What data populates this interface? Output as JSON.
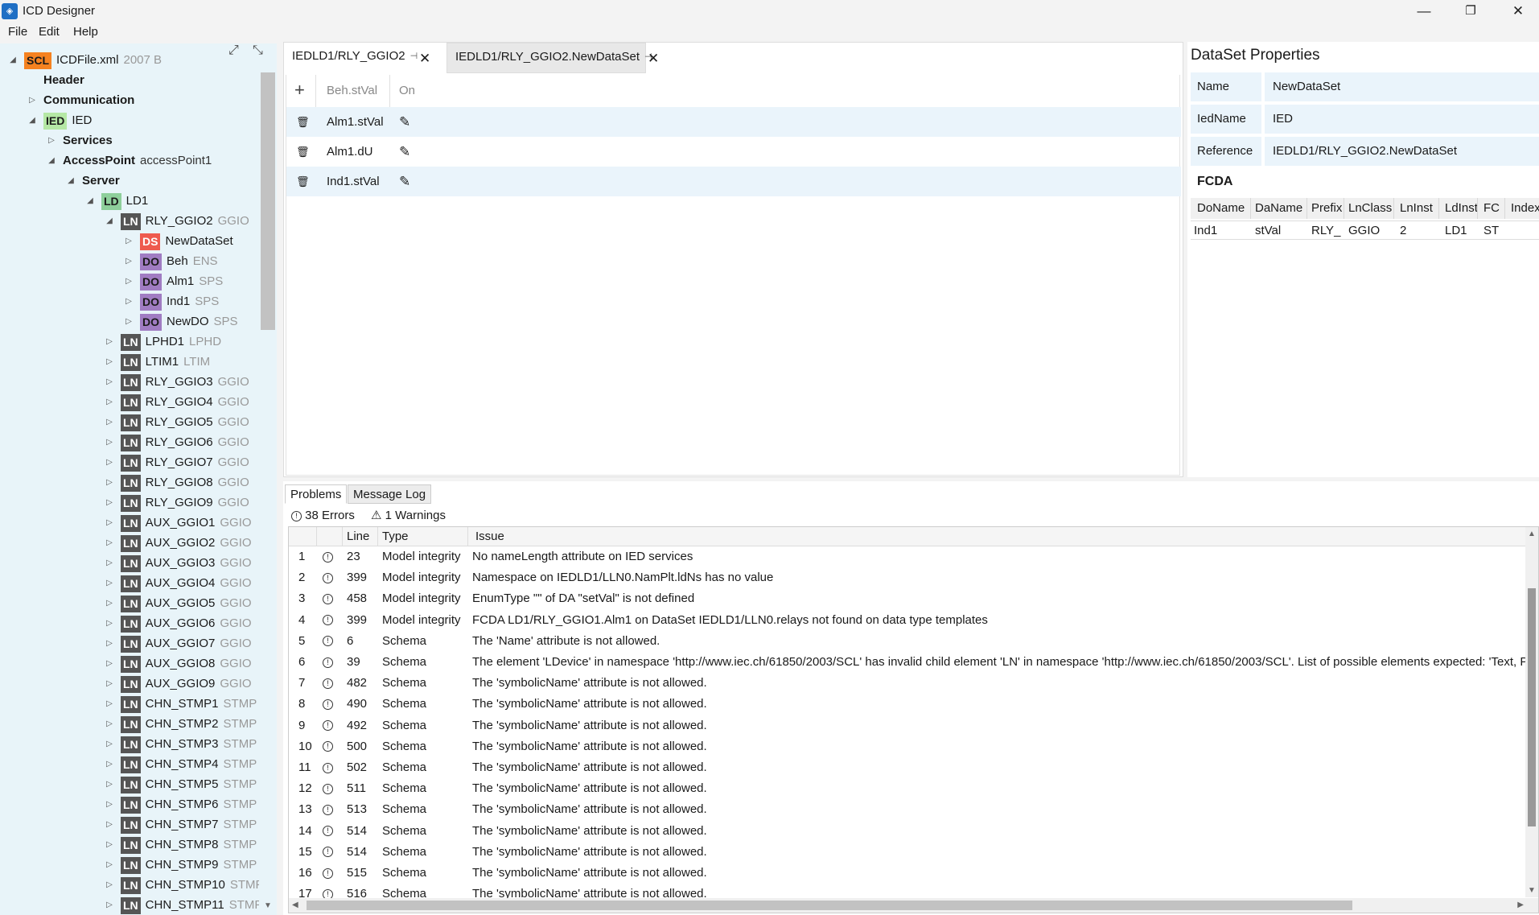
{
  "window": {
    "title": "ICD Designer",
    "controls": {
      "minimize": "—",
      "maximize": "❐",
      "close": "✕"
    }
  },
  "menu": [
    "File",
    "Edit",
    "Help"
  ],
  "tree": {
    "root": {
      "badge": "SCL",
      "name": "ICDFile.xml",
      "sub": "2007 B"
    },
    "header": "Header",
    "communication": "Communication",
    "ied": {
      "badge": "IED",
      "name": "IED"
    },
    "services": "Services",
    "accesspoint": {
      "name": "AccessPoint",
      "sub": "accessPoint1"
    },
    "server": "Server",
    "ld": {
      "badge": "LD",
      "name": "LD1"
    },
    "ln_open": {
      "badge": "LN",
      "name": "RLY_GGIO2",
      "sub": "GGIO"
    },
    "children": [
      {
        "badge": "DS",
        "name": "NewDataSet",
        "sub": ""
      },
      {
        "badge": "DO",
        "name": "Beh",
        "sub": "ENS"
      },
      {
        "badge": "DO",
        "name": "Alm1",
        "sub": "SPS"
      },
      {
        "badge": "DO",
        "name": "Ind1",
        "sub": "SPS"
      },
      {
        "badge": "DO",
        "name": "NewDO",
        "sub": "SPS"
      }
    ],
    "lns": [
      {
        "badge": "LN",
        "name": "LPHD1",
        "sub": "LPHD"
      },
      {
        "badge": "LN",
        "name": "LTIM1",
        "sub": "LTIM"
      },
      {
        "badge": "LN",
        "name": "RLY_GGIO3",
        "sub": "GGIO"
      },
      {
        "badge": "LN",
        "name": "RLY_GGIO4",
        "sub": "GGIO"
      },
      {
        "badge": "LN",
        "name": "RLY_GGIO5",
        "sub": "GGIO"
      },
      {
        "badge": "LN",
        "name": "RLY_GGIO6",
        "sub": "GGIO"
      },
      {
        "badge": "LN",
        "name": "RLY_GGIO7",
        "sub": "GGIO"
      },
      {
        "badge": "LN",
        "name": "RLY_GGIO8",
        "sub": "GGIO"
      },
      {
        "badge": "LN",
        "name": "RLY_GGIO9",
        "sub": "GGIO"
      },
      {
        "badge": "LN",
        "name": "AUX_GGIO1",
        "sub": "GGIO"
      },
      {
        "badge": "LN",
        "name": "AUX_GGIO2",
        "sub": "GGIO"
      },
      {
        "badge": "LN",
        "name": "AUX_GGIO3",
        "sub": "GGIO"
      },
      {
        "badge": "LN",
        "name": "AUX_GGIO4",
        "sub": "GGIO"
      },
      {
        "badge": "LN",
        "name": "AUX_GGIO5",
        "sub": "GGIO"
      },
      {
        "badge": "LN",
        "name": "AUX_GGIO6",
        "sub": "GGIO"
      },
      {
        "badge": "LN",
        "name": "AUX_GGIO7",
        "sub": "GGIO"
      },
      {
        "badge": "LN",
        "name": "AUX_GGIO8",
        "sub": "GGIO"
      },
      {
        "badge": "LN",
        "name": "AUX_GGIO9",
        "sub": "GGIO"
      },
      {
        "badge": "LN",
        "name": "CHN_STMP1",
        "sub": "STMP"
      },
      {
        "badge": "LN",
        "name": "CHN_STMP2",
        "sub": "STMP"
      },
      {
        "badge": "LN",
        "name": "CHN_STMP3",
        "sub": "STMP"
      },
      {
        "badge": "LN",
        "name": "CHN_STMP4",
        "sub": "STMP"
      },
      {
        "badge": "LN",
        "name": "CHN_STMP5",
        "sub": "STMP"
      },
      {
        "badge": "LN",
        "name": "CHN_STMP6",
        "sub": "STMP"
      },
      {
        "badge": "LN",
        "name": "CHN_STMP7",
        "sub": "STMP"
      },
      {
        "badge": "LN",
        "name": "CHN_STMP8",
        "sub": "STMP"
      },
      {
        "badge": "LN",
        "name": "CHN_STMP9",
        "sub": "STMP"
      },
      {
        "badge": "LN",
        "name": "CHN_STMP10",
        "sub": "STMP"
      },
      {
        "badge": "LN",
        "name": "CHN_STMP11",
        "sub": "STMP"
      }
    ]
  },
  "editor": {
    "tabs": [
      {
        "label": "IEDLD1/RLY_GGIO2",
        "active": true
      },
      {
        "label": "IEDLD1/RLY_GGIO2.NewDataSet",
        "active": false
      }
    ],
    "header": {
      "col1": "Beh.stVal",
      "col2": "On"
    },
    "rows": [
      "Alm1.stVal",
      "Alm1.dU",
      "Ind1.stVal"
    ]
  },
  "properties": {
    "title": "DataSet Properties",
    "fields": [
      {
        "label": "Name",
        "value": "NewDataSet"
      },
      {
        "label": "IedName",
        "value": "IED"
      },
      {
        "label": "Reference",
        "value": "IEDLD1/RLY_GGIO2.NewDataSet"
      }
    ],
    "fcda_title": "FCDA",
    "fcda_columns": [
      "DoName",
      "DaName",
      "Prefix",
      "LnClass",
      "LnInst",
      "LdInst",
      "FC",
      "Index"
    ],
    "fcda_rows": [
      [
        "Ind1",
        "stVal",
        "RLY_",
        "GGIO",
        "2",
        "LD1",
        "ST",
        ""
      ]
    ]
  },
  "bottom": {
    "tabs": [
      "Problems",
      "Message Log"
    ],
    "errors_label": "38 Errors",
    "warnings_label": "1 Warnings",
    "columns": [
      "Line",
      "Type",
      "Issue"
    ],
    "issues": [
      [
        "1",
        "23",
        "Model integrity",
        "No nameLength attribute on IED services"
      ],
      [
        "2",
        "399",
        "Model integrity",
        "Namespace on IEDLD1/LLN0.NamPlt.ldNs has no value"
      ],
      [
        "3",
        "458",
        "Model integrity",
        "EnumType \"\" of DA \"setVal\" is not defined"
      ],
      [
        "4",
        "399",
        "Model integrity",
        "FCDA LD1/RLY_GGIO1.Alm1 on DataSet IEDLD1/LLN0.relays not found on data type templates"
      ],
      [
        "5",
        "6",
        "Schema",
        "The 'Name' attribute is not allowed."
      ],
      [
        "6",
        "39",
        "Schema",
        "The element 'LDevice' in namespace 'http://www.iec.ch/61850/2003/SCL' has invalid child element 'LN' in namespace 'http://www.iec.ch/61850/2003/SCL'. List of possible elements expected: 'Text, Pri"
      ],
      [
        "7",
        "482",
        "Schema",
        "The 'symbolicName' attribute is not allowed."
      ],
      [
        "8",
        "490",
        "Schema",
        "The 'symbolicName' attribute is not allowed."
      ],
      [
        "9",
        "492",
        "Schema",
        "The 'symbolicName' attribute is not allowed."
      ],
      [
        "10",
        "500",
        "Schema",
        "The 'symbolicName' attribute is not allowed."
      ],
      [
        "11",
        "502",
        "Schema",
        "The 'symbolicName' attribute is not allowed."
      ],
      [
        "12",
        "511",
        "Schema",
        "The 'symbolicName' attribute is not allowed."
      ],
      [
        "13",
        "513",
        "Schema",
        "The 'symbolicName' attribute is not allowed."
      ],
      [
        "14",
        "514",
        "Schema",
        "The 'symbolicName' attribute is not allowed."
      ],
      [
        "15",
        "514",
        "Schema",
        "The 'symbolicName' attribute is not allowed."
      ],
      [
        "16",
        "515",
        "Schema",
        "The 'symbolicName' attribute is not allowed."
      ],
      [
        "17",
        "516",
        "Schema",
        "The 'symbolicName' attribute is not allowed."
      ]
    ]
  },
  "icons": {
    "expand": "⤢",
    "collapse": "⤡",
    "add": "+",
    "trash": "🗑",
    "edit": "✎",
    "pin": "⊣",
    "close": "✕"
  }
}
